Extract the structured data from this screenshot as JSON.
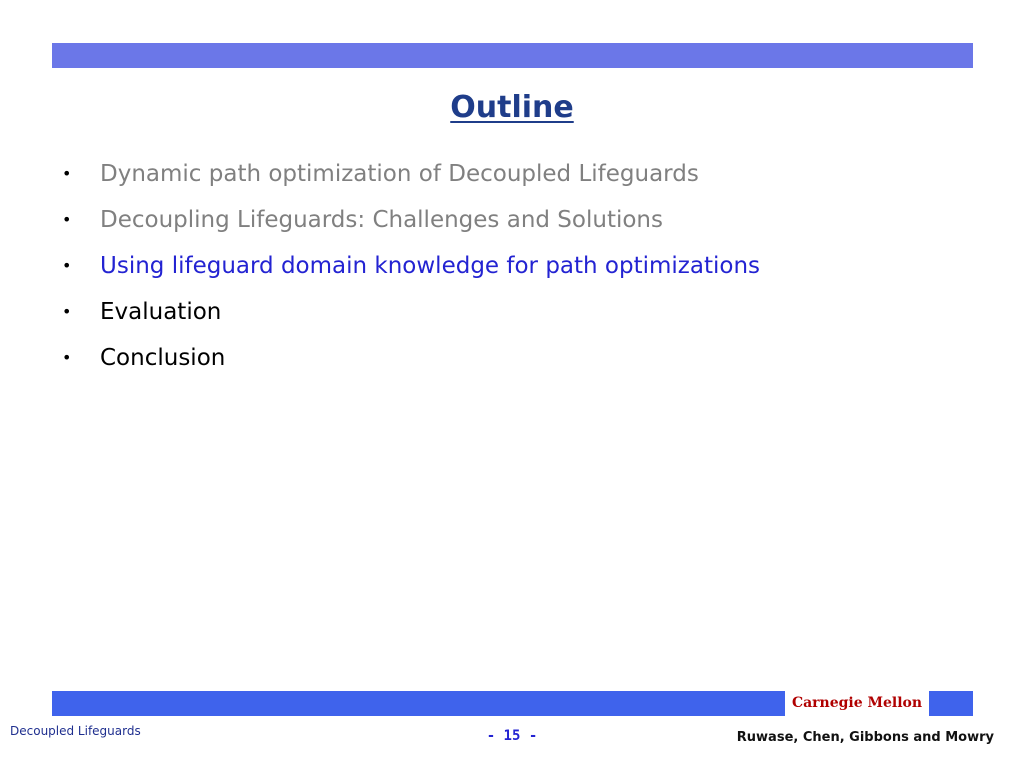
{
  "slide": {
    "title": "Outline",
    "bullets": [
      {
        "text": "Dynamic path optimization of Decoupled Lifeguards",
        "color": "#808080"
      },
      {
        "text": "Decoupling Lifeguards: Challenges and Solutions",
        "color": "#808080"
      },
      {
        "text": "Using lifeguard domain knowledge for path optimizations",
        "color": "#2323d2"
      },
      {
        "text": "Evaluation",
        "color": "#000000"
      },
      {
        "text": "Conclusion",
        "color": "#000000"
      }
    ],
    "bullet_symbol": "•"
  },
  "footer": {
    "brand": "Carnegie Mellon",
    "left": "Decoupled Lifeguards",
    "page": "- 15 -",
    "authors": "Ruwase, Chen, Gibbons and Mowry"
  },
  "colors": {
    "top_bar": "#6b77e8",
    "bottom_bar": "#3f63ec",
    "title": "#1f3d8a",
    "brand": "#b00000"
  }
}
